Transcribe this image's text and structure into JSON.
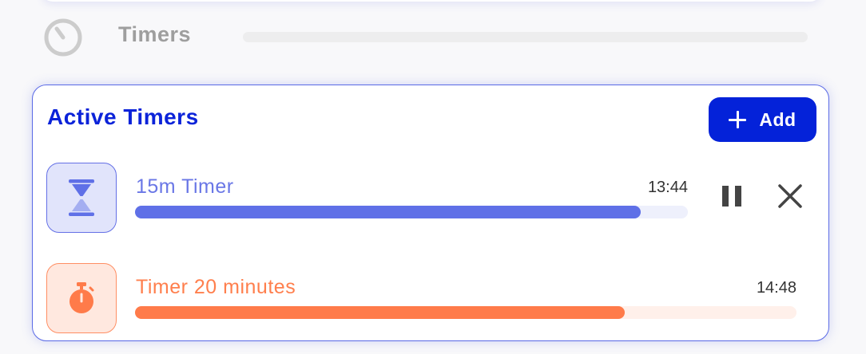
{
  "header": {
    "title": "Timers",
    "icon": "timer-icon"
  },
  "panel": {
    "title": "Active Timers",
    "add_button": {
      "label": "Add",
      "icon": "plus-icon"
    }
  },
  "timers": [
    {
      "name": "15m Timer",
      "time": "13:44",
      "progress": 0.915,
      "icon": "hourglass-icon",
      "color": "#5f70e7",
      "actions": [
        "pause-icon",
        "close-icon"
      ]
    },
    {
      "name": "Timer 20 minutes",
      "time": "14:48",
      "progress": 0.74,
      "icon": "stopwatch-icon",
      "color": "#ff7b4a",
      "actions": []
    }
  ],
  "colors": {
    "accent": "#0422d9",
    "timer1": "#5f70e7",
    "timer2": "#ff7b4a"
  }
}
